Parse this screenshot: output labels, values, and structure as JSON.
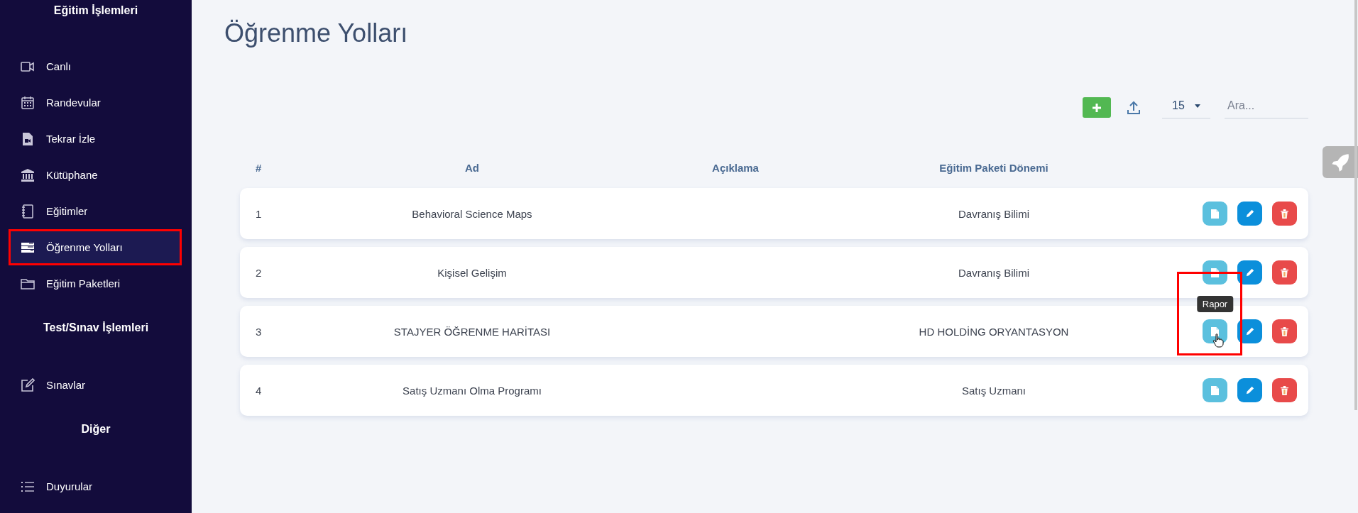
{
  "sidebar": {
    "sections": [
      {
        "title": "Eğitim İşlemleri",
        "items": [
          {
            "label": "Canlı",
            "selected": false,
            "highlighted": false
          },
          {
            "label": "Randevular",
            "selected": false,
            "highlighted": false
          },
          {
            "label": "Tekrar İzle",
            "selected": false,
            "highlighted": false
          },
          {
            "label": "Kütüphane",
            "selected": false,
            "highlighted": false
          },
          {
            "label": "Eğitimler",
            "selected": false,
            "highlighted": false
          },
          {
            "label": "Öğrenme Yolları",
            "selected": true,
            "highlighted": true
          },
          {
            "label": "Eğitim Paketleri",
            "selected": false,
            "highlighted": false
          }
        ]
      },
      {
        "title": "Test/Sınav İşlemleri",
        "items": [
          {
            "label": "Sınavlar",
            "selected": false,
            "highlighted": false
          }
        ]
      },
      {
        "title": "Diğer",
        "items": [
          {
            "label": "Duyurular",
            "selected": false,
            "highlighted": false
          }
        ]
      }
    ]
  },
  "page": {
    "title": "Öğrenme Yolları"
  },
  "toolbar": {
    "page_size": "15",
    "search": {
      "placeholder": "Ara..."
    }
  },
  "table": {
    "columns": [
      "#",
      "Ad",
      "Açıklama",
      "Eğitim Paketi Dönemi"
    ],
    "rows": [
      {
        "number": "1",
        "name": "Behavioral Science Maps",
        "period": "Davranış Bilimi",
        "highlighted": false
      },
      {
        "number": "2",
        "name": "Kişisel Gelişim",
        "period": "Davranış Bilimi",
        "highlighted": false
      },
      {
        "number": "3",
        "name": "STAJYER ÖĞRENME HARİTASI",
        "period": "HD HOLDİNG ORYANTASYON",
        "highlighted": true,
        "tooltip": "Rapor"
      },
      {
        "number": "4",
        "name": "Satış Uzmanı Olma Programı",
        "period": "Satış Uzmanı",
        "highlighted": false
      }
    ]
  }
}
